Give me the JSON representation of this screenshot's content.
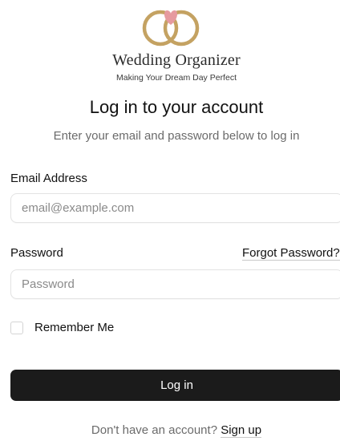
{
  "brand": {
    "name": "Wedding Organizer",
    "tagline": "Making Your Dream Day Perfect",
    "logo_icon": "wedding-rings-heart-icon",
    "ring_color": "#c4a262",
    "heart_color": "#e69a9f"
  },
  "page": {
    "heading": "Log in to your account",
    "subheading": "Enter your email and password below to log in"
  },
  "form": {
    "email_label": "Email Address",
    "email_placeholder": "email@example.com",
    "email_value": "",
    "password_label": "Password",
    "password_placeholder": "Password",
    "password_value": "",
    "forgot_password": "Forgot Password?",
    "remember_me": "Remember Me",
    "remember_checked": false,
    "submit_label": "Log in"
  },
  "footer": {
    "prompt": "Don't have an account?",
    "signup_label": "Sign up"
  },
  "colors": {
    "primary_button": "#1b1b1b",
    "muted_text": "#6b6b6b"
  }
}
